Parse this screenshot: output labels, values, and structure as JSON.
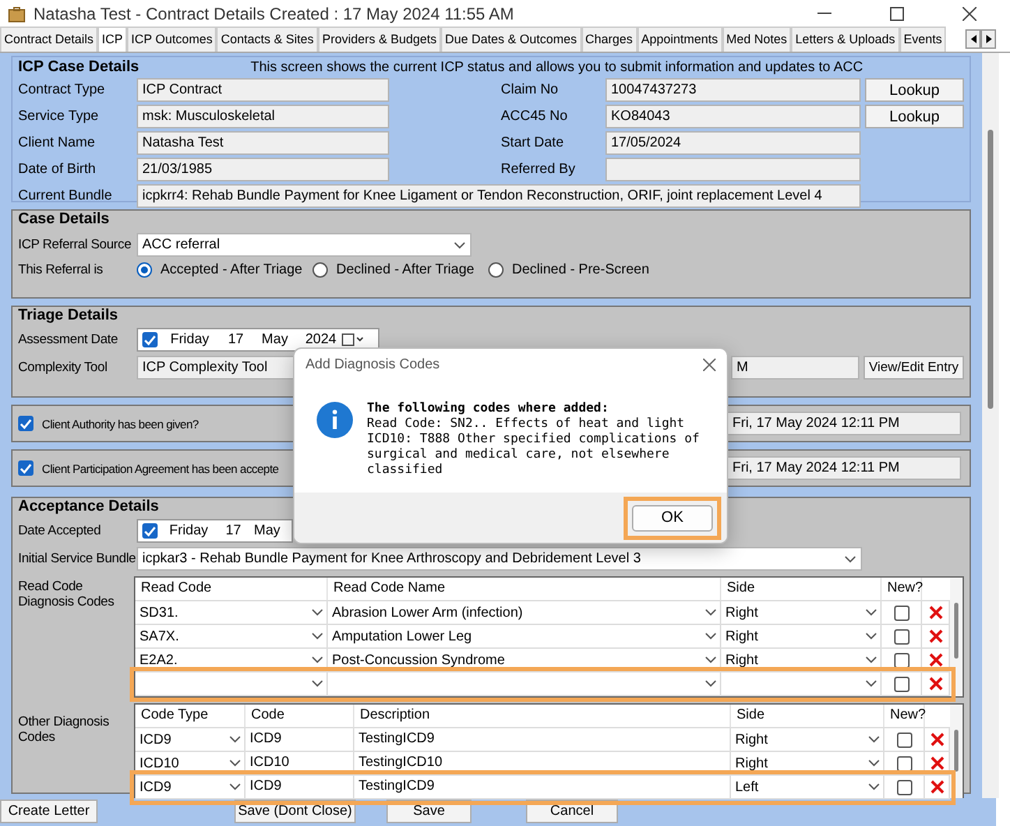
{
  "window": {
    "title": "Natasha Test - Contract Details Created : 17 May 2024 11:55 AM"
  },
  "tabs": [
    {
      "label": "Contract Details",
      "selected": false
    },
    {
      "label": "ICP",
      "selected": true
    },
    {
      "label": "ICP Outcomes",
      "selected": false
    },
    {
      "label": "Contacts & Sites",
      "selected": false
    },
    {
      "label": "Providers & Budgets",
      "selected": false
    },
    {
      "label": "Due Dates & Outcomes",
      "selected": false
    },
    {
      "label": "Charges",
      "selected": false
    },
    {
      "label": "Appointments",
      "selected": false
    },
    {
      "label": "Med Notes",
      "selected": false
    },
    {
      "label": "Letters & Uploads",
      "selected": false
    },
    {
      "label": "Events",
      "selected": false
    }
  ],
  "icp_case_details": {
    "title": "ICP Case Details",
    "note": "This screen shows the current ICP status and  allows you to submit information and updates to ACC",
    "rows": [
      {
        "label": "Contract Type",
        "value": "ICP Contract",
        "right_label": "Claim No",
        "right_value": "10047437273",
        "button": "Lookup"
      },
      {
        "label": "Service Type",
        "value": "msk: Musculoskeletal",
        "right_label": "ACC45 No",
        "right_value": "KO84043",
        "button": "Lookup"
      },
      {
        "label": "Client Name",
        "value": "Natasha Test",
        "right_label": "Start Date",
        "right_value": "17/05/2024"
      },
      {
        "label": "Date of Birth",
        "value": "21/03/1985",
        "right_label": "Referred By"
      }
    ],
    "bundle": {
      "label": "Current Bundle",
      "value": "icpkrr4: Rehab Bundle Payment for Knee Ligament or Tendon Reconstruction, ORIF, joint replacement Level 4"
    }
  },
  "case_details": {
    "title": "Case Details",
    "referral_source": {
      "label": "ICP Referral Source",
      "value": "ACC referral"
    },
    "referral_is": {
      "label": "This Referral is",
      "options": [
        {
          "label": "Accepted - After Triage",
          "selected": true
        },
        {
          "label": "Declined - After Triage",
          "selected": false
        },
        {
          "label": "Declined - Pre-Screen",
          "selected": false
        }
      ]
    }
  },
  "triage": {
    "title": "Triage Details",
    "assessment_date": {
      "label": "Assessment Date",
      "checked": true,
      "day": "Friday",
      "date": "17",
      "month": "May",
      "year": "2024"
    },
    "complexity_tool": {
      "label": "Complexity Tool",
      "value": "ICP Complexity Tool",
      "value_2": "M",
      "button": "View/Edit Entry"
    }
  },
  "agreements": [
    {
      "label": "Client Authority has been given?",
      "checked": true,
      "datetime": "Fri, 17 May 2024 12:11 PM"
    },
    {
      "label": "Client Participation Agreement has been accepte",
      "checked": true,
      "datetime": "Fri, 17 May 2024 12:11 PM"
    }
  ],
  "acceptance": {
    "title": "Acceptance Details",
    "date_accepted": {
      "label": "Date Accepted",
      "checked": true,
      "day": "Friday",
      "date": "17",
      "month": "May"
    },
    "initial_bundle": {
      "label": "Initial Service Bundle",
      "value": "icpkar3 - Rehab Bundle Payment for Knee Arthroscopy and Debridement Level 3"
    },
    "read_codes": {
      "label": "Read Code Diagnosis Codes",
      "columns": [
        "Read Code",
        "Read Code Name",
        "Side",
        "New?"
      ],
      "rows": [
        {
          "code": "SD31.",
          "name": "Abrasion Lower Arm (infection)",
          "side": "Right",
          "new": false,
          "highlighted": false
        },
        {
          "code": "SA7X.",
          "name": "Amputation Lower Leg",
          "side": "Right",
          "new": false,
          "highlighted": false
        },
        {
          "code": "E2A2.",
          "name": "Post-Concussion Syndrome",
          "side": "Right",
          "new": false,
          "highlighted": false
        },
        {
          "new": false,
          "highlighted": true
        }
      ]
    },
    "other_codes": {
      "label": "Other Diagnosis Codes",
      "columns": [
        "Code Type",
        "Code",
        "Description",
        "Side",
        "New?"
      ],
      "rows": [
        {
          "code_type": "ICD9",
          "code": "ICD9",
          "description": "TestingICD9",
          "side": "Right",
          "new": false,
          "highlighted": false
        },
        {
          "code_type": "ICD10",
          "code": "ICD10",
          "description": "TestingICD10",
          "side": "Right",
          "new": false,
          "highlighted": false
        },
        {
          "code_type": "ICD9",
          "code": "ICD9",
          "description": "TestingICD9",
          "side": "Left",
          "new": false,
          "highlighted": true
        }
      ]
    }
  },
  "dialog": {
    "title": "Add Diagnosis Codes",
    "heading": "The following codes where added:",
    "lines": [
      "Read Code: SN2.. Effects of heat and light",
      "ICD10: T888 Other specified complications of surgical and medical care, not elsewhere classified"
    ],
    "button": "OK",
    "button_highlighted": true
  },
  "footer_buttons": [
    {
      "label": "Create Letter"
    },
    {
      "label": "Save (Dont Close)"
    },
    {
      "label": "Save"
    },
    {
      "label": "Cancel"
    }
  ]
}
